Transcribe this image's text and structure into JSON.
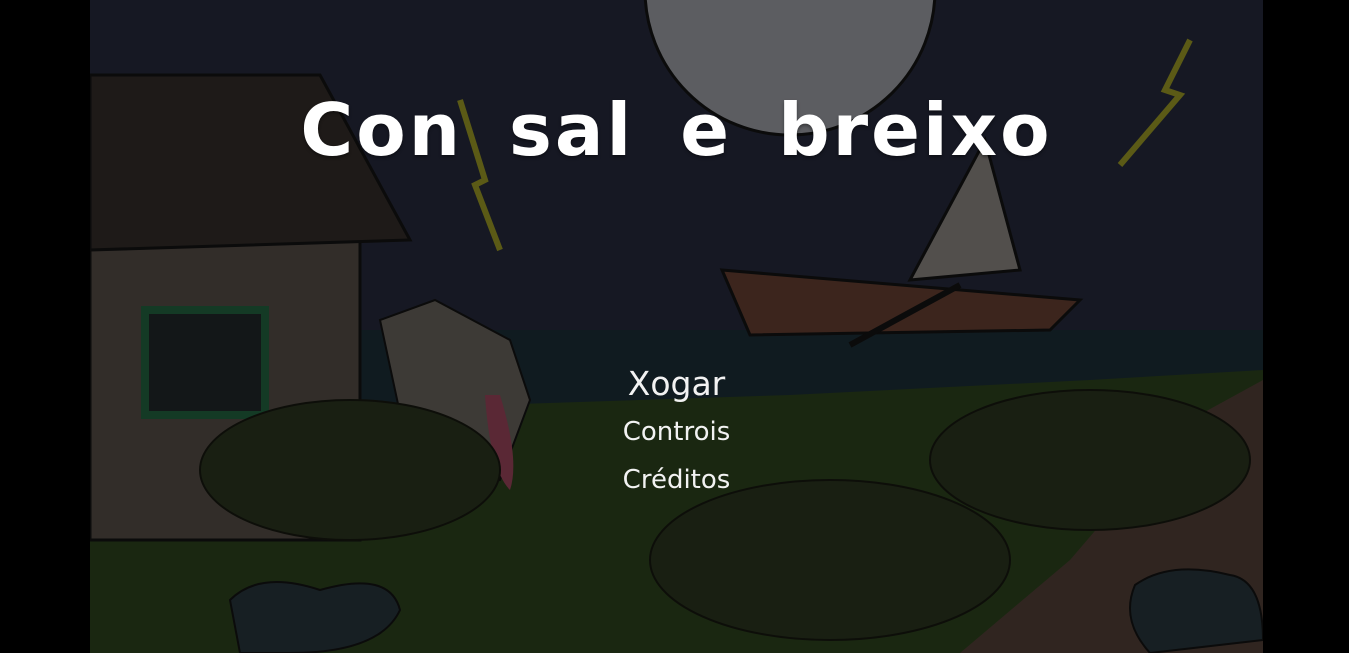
{
  "game": {
    "title": "Con sal e breixo",
    "menu": {
      "play": "Xogar",
      "controls": "Controis",
      "credits": "Créditos"
    }
  },
  "colors": {
    "sky": "#1c1f2c",
    "moon": "#d7d9dc",
    "grass": "#2f4a1e",
    "path": "#7a5a45",
    "text": "#ffffff",
    "lightning": "#b7b32a",
    "flowers": "#c04a8c"
  }
}
